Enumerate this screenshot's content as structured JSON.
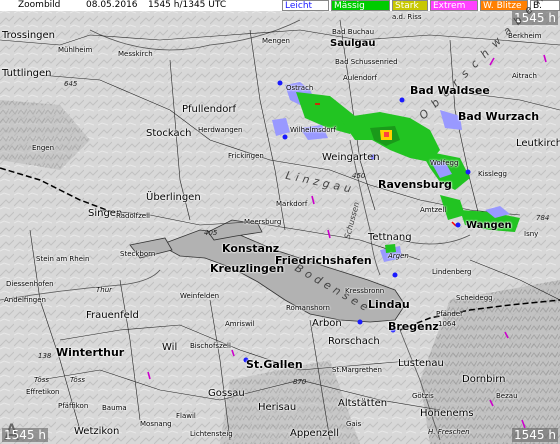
{
  "header": {
    "product": "Zoombild",
    "date": "08.05.2016",
    "time": "1545 h/1345 UTC",
    "legend": [
      {
        "label": "Leicht",
        "bg": "#ffffff",
        "fg": "#1a1aff"
      },
      {
        "label": "Mässig",
        "bg": "#00cc00",
        "fg": "#ffffff"
      },
      {
        "label": "Stark",
        "bg": "#c8c800",
        "fg": "#ffffff"
      },
      {
        "label": "Extrem",
        "bg": "#ff40ff",
        "fg": "#ffffff"
      },
      {
        "label": "W. Blitze",
        "bg": "#ff8000",
        "fg": "#ffffff"
      },
      {
        "label": "B.",
        "bg": "#ffffff",
        "fg": "#000000"
      }
    ]
  },
  "corners": {
    "top_right": "1545 h",
    "bottom_left": "1545 h",
    "bottom_right": "1545 h"
  },
  "colors": {
    "rain_light": "#9999ff",
    "rain_moderate": "#22c422",
    "rain_heavy": "#ffd000",
    "lightning": "#cc00cc",
    "lake": "#b4b4b4",
    "terrain": "#d7d7d7"
  },
  "places": {
    "trossingen": "Trossingen",
    "muhlheim": "Mühlheim",
    "messkirch": "Messkirch",
    "mengen": "Mengen",
    "bad_buchau": "Bad Buchau",
    "saulgau": "Saulgau",
    "bad_schussenried": "Bad Schussenried",
    "aulendorf": "Aulendorf",
    "ad_riss": "a.d. Riss",
    "berkheim": "Berkheim",
    "tuttlingen": "Tuttlingen",
    "ostrach": "Ostrach",
    "bad_waldsee": "Bad Waldsee",
    "aitrach": "Aitrach",
    "pfullendorf": "Pfullendorf",
    "wilhelmsdorf": "Wilhelmsdorf",
    "bad_wurzach": "Bad Wurzach",
    "stockach": "Stockach",
    "herdwangen": "Herdwangen",
    "leutkirch": "Leutkirch",
    "engen": "Engen",
    "frickingen": "Frickingen",
    "weingarten": "Weingarten",
    "wolfegg": "Wolfegg",
    "kisslegg": "Kisslegg",
    "uberlingen": "Überlingen",
    "ravensburg": "Ravensburg",
    "singen": "Singen",
    "radolfzell": "Radolfzell",
    "markdorf": "Markdorf",
    "amtzell": "Amtzell",
    "meersburg": "Meersburg",
    "wangen": "Wangen",
    "isny": "Isny",
    "stein_am_rhein": "Stein am Rhein",
    "steckborn": "Steckborn",
    "tettnang": "Tettnang",
    "konstanz": "Konstanz",
    "kreuzlingen": "Kreuzlingen",
    "friedrichshafen": "Friedrichshafen",
    "argen": "Argen",
    "diessenhofen": "Diessenhofen",
    "lindenberg": "Lindenberg",
    "andelfingen": "Andelfingen",
    "thur": "Thur",
    "kressbronn": "Kressbronn",
    "weinfelden": "Weinfelden",
    "lindau": "Lindau",
    "scheidegg": "Scheidegg",
    "frauenfeld": "Frauenfeld",
    "amriswil": "Amriswil",
    "romanshorn": "Romanshorn",
    "arbon": "Arbon",
    "bregenz": "Bregenz",
    "pfander": "Pfänder",
    "pfander_alt": "1064",
    "winterthur": "Winterthur",
    "wil": "Wil",
    "bischofszell": "Bischofszell",
    "rorschach": "Rorschach",
    "lustenau": "Lustenau",
    "dornbirn": "Dornbirn",
    "st_gallen": "St.Gallen",
    "st_margrethen": "St.Margrethen",
    "tos": "Töss",
    "toss": "Töss",
    "effretikon": "Effretikon",
    "gossau": "Gossau",
    "gotzis": "Götzis",
    "bezau": "Bezau",
    "pfaffikon": "Pfäffikon",
    "bauma": "Bauma",
    "herisau": "Herisau",
    "altstatten": "Altstätten",
    "hohenems": "Hohenems",
    "wetzikon": "Wetzikon",
    "lichtensteig": "Lichtensteig",
    "appenzell": "Appenzell",
    "h_freschen": "H. Freschen",
    "gais": "Gais",
    "mosnang": "Mosnang",
    "flawil": "Flawil"
  },
  "regions": {
    "linzgau": "Linzgau",
    "oberschwaben": "Oberschwaben",
    "bodensee": "Bodensee",
    "schussen": "Schussen"
  },
  "roads": {
    "r645": "645",
    "r450": "450",
    "r405": "405",
    "r870": "870",
    "r138": "138",
    "r784": "784"
  }
}
